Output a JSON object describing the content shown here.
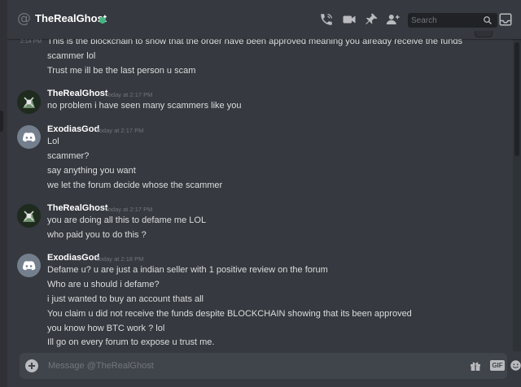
{
  "header": {
    "channel_title": "TheRealGhost",
    "status_color": "#43b581",
    "icons": [
      "at-icon",
      "call-icon",
      "video-icon",
      "pin-icon",
      "add-friend-icon",
      "inbox-icon"
    ],
    "search_placeholder": "Search"
  },
  "messages": [
    {
      "type": "continuation",
      "timestamp": "2:14 PM",
      "text": "This is the blockchain to show that the order have been approved meaning you already receive the funds"
    },
    {
      "type": "continuation",
      "text": "scammer lol"
    },
    {
      "type": "continuation",
      "text": "Trust me ill be the last person u scam"
    },
    {
      "type": "group",
      "author": "TheRealGhost",
      "time": "Today at 2:17 PM",
      "avatar": "ghost-avatar",
      "lines": [
        "no problem i have seen many scammers like you"
      ]
    },
    {
      "type": "group",
      "author": "ExodiasGod",
      "time": "Today at 2:17 PM",
      "avatar": "discord-default-avatar",
      "lines": [
        "Lol",
        "scammer?",
        "say anything you want",
        "we let the forum decide whose the scammer"
      ]
    },
    {
      "type": "group",
      "author": "TheRealGhost",
      "time": "Today at 2:17 PM",
      "avatar": "ghost-avatar",
      "lines": [
        "you are doing all this to defame me LOL",
        "who paid you to do this ?"
      ]
    },
    {
      "type": "group",
      "author": "ExodiasGod",
      "time": "Today at 2:18 PM",
      "avatar": "discord-default-avatar",
      "lines": [
        "Defame u? u are just a indian seller with 1 positive review on the forum",
        "Who are u should i defame?",
        "i just wanted to buy an account thats all",
        "You claim u did not receive the funds despite BLOCKCHAIN showing that its been approved",
        "you know how BTC work ? lol",
        "Ill go on every forum to expose u trust me."
      ]
    }
  ],
  "composer": {
    "placeholder": "Message @TheRealGhost",
    "gif_label": "GIF",
    "icons": [
      "add-attachment-icon",
      "gift-icon",
      "gif-icon",
      "emoji-icon"
    ]
  }
}
